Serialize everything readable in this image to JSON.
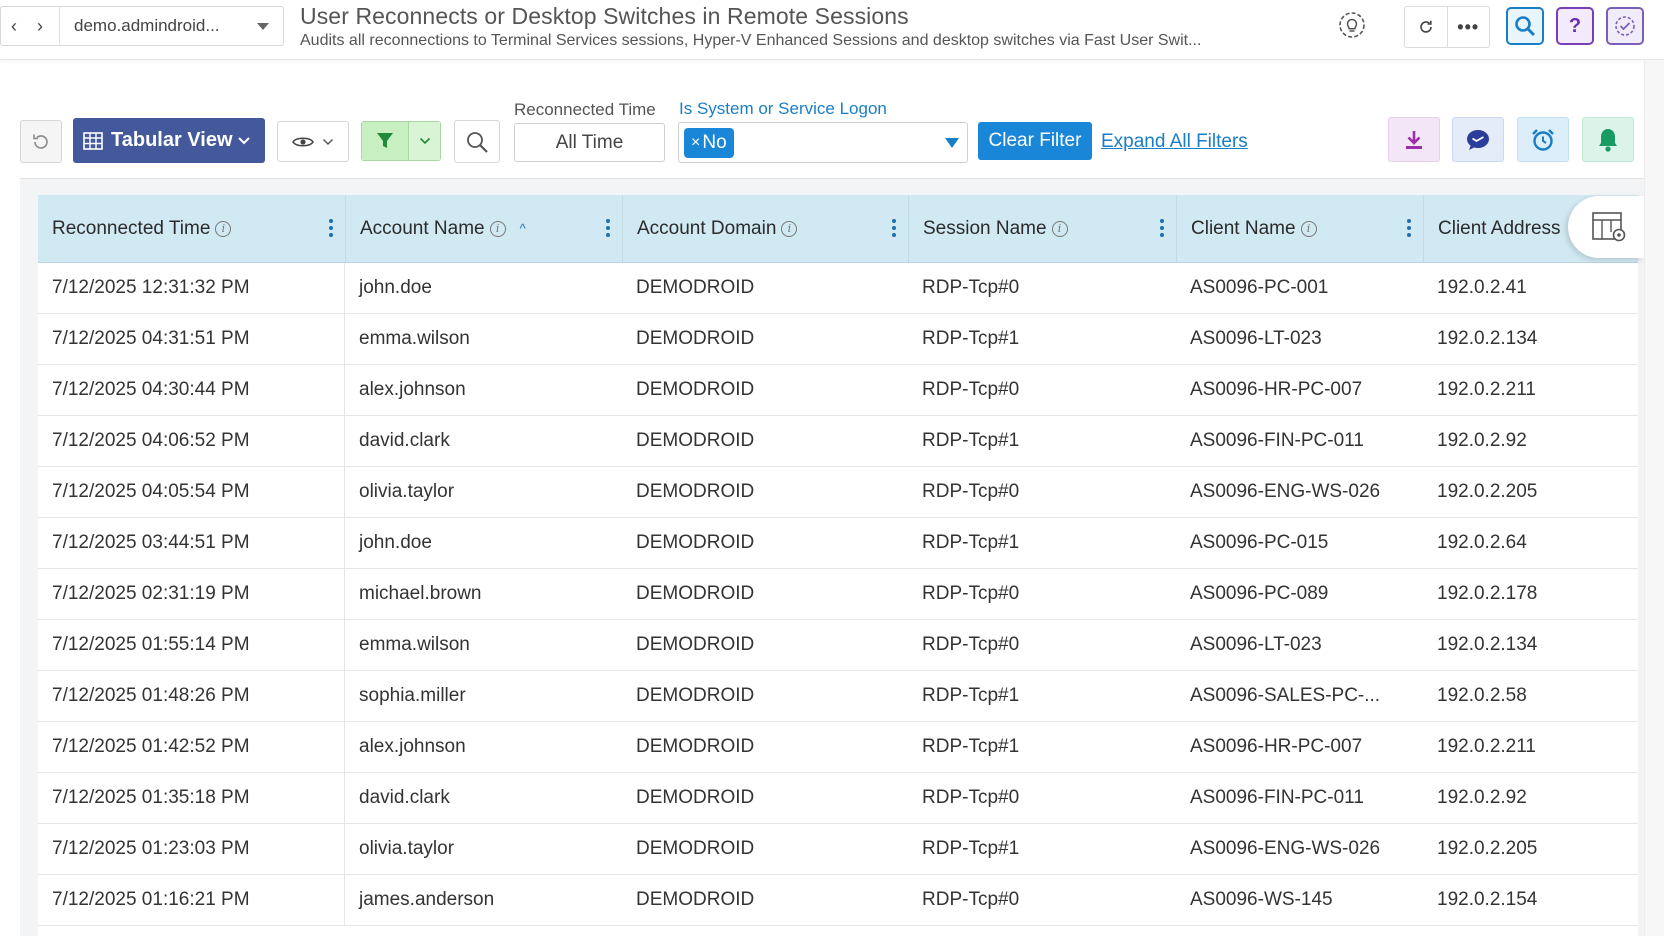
{
  "header": {
    "domain_selector": "demo.admindroid...",
    "title": "User Reconnects or Desktop Switches in Remote Sessions",
    "subtitle": "Audits all reconnections to Terminal Services sessions, Hyper-V Enhanced Sessions and desktop switches via Fast User Swit...",
    "help_label": "?"
  },
  "toolbar": {
    "view_label": "Tabular View",
    "reconnected_time_label": "Reconnected Time",
    "reconnected_time_value": "All Time",
    "system_logon_label": "Is System or Service Logon",
    "system_logon_chip_x": "×",
    "system_logon_chip": "No",
    "clear_filter_label": "Clear Filter",
    "expand_filters_label": "Expand All Filters"
  },
  "colors": {
    "accent": "#1a86d8",
    "view_button": "#44599c",
    "header_row": "#d1e9f2"
  },
  "table": {
    "columns": [
      "Reconnected Time",
      "Account Name",
      "Account Domain",
      "Session Name",
      "Client Name",
      "Client Address"
    ],
    "sorted_column": "Account Name",
    "sort_direction": "ascending",
    "rows": [
      [
        "7/12/2025 12:31:32 PM",
        "john.doe",
        "DEMODROID",
        "RDP-Tcp#0",
        "AS0096-PC-001",
        "192.0.2.41"
      ],
      [
        "7/12/2025 04:31:51 PM",
        "emma.wilson",
        "DEMODROID",
        "RDP-Tcp#1",
        "AS0096-LT-023",
        "192.0.2.134"
      ],
      [
        "7/12/2025 04:30:44 PM",
        "alex.johnson",
        "DEMODROID",
        "RDP-Tcp#0",
        "AS0096-HR-PC-007",
        "192.0.2.211"
      ],
      [
        "7/12/2025 04:06:52 PM",
        "david.clark",
        "DEMODROID",
        "RDP-Tcp#1",
        "AS0096-FIN-PC-011",
        "192.0.2.92"
      ],
      [
        "7/12/2025 04:05:54 PM",
        "olivia.taylor",
        "DEMODROID",
        "RDP-Tcp#0",
        "AS0096-ENG-WS-026",
        "192.0.2.205"
      ],
      [
        "7/12/2025 03:44:51 PM",
        "john.doe",
        "DEMODROID",
        "RDP-Tcp#1",
        "AS0096-PC-015",
        "192.0.2.64"
      ],
      [
        "7/12/2025 02:31:19 PM",
        "michael.brown",
        "DEMODROID",
        "RDP-Tcp#0",
        "AS0096-PC-089",
        "192.0.2.178"
      ],
      [
        "7/12/2025 01:55:14 PM",
        "emma.wilson",
        "DEMODROID",
        "RDP-Tcp#0",
        "AS0096-LT-023",
        "192.0.2.134"
      ],
      [
        "7/12/2025 01:48:26 PM",
        "sophia.miller",
        "DEMODROID",
        "RDP-Tcp#1",
        "AS0096-SALES-PC-...",
        "192.0.2.58"
      ],
      [
        "7/12/2025 01:42:52 PM",
        "alex.johnson",
        "DEMODROID",
        "RDP-Tcp#1",
        "AS0096-HR-PC-007",
        "192.0.2.211"
      ],
      [
        "7/12/2025 01:35:18 PM",
        "david.clark",
        "DEMODROID",
        "RDP-Tcp#0",
        "AS0096-FIN-PC-011",
        "192.0.2.92"
      ],
      [
        "7/12/2025 01:23:03 PM",
        "olivia.taylor",
        "DEMODROID",
        "RDP-Tcp#1",
        "AS0096-ENG-WS-026",
        "192.0.2.205"
      ],
      [
        "7/12/2025 01:16:21 PM",
        "james.anderson",
        "DEMODROID",
        "RDP-Tcp#0",
        "AS0096-WS-145",
        "192.0.2.154"
      ]
    ]
  }
}
